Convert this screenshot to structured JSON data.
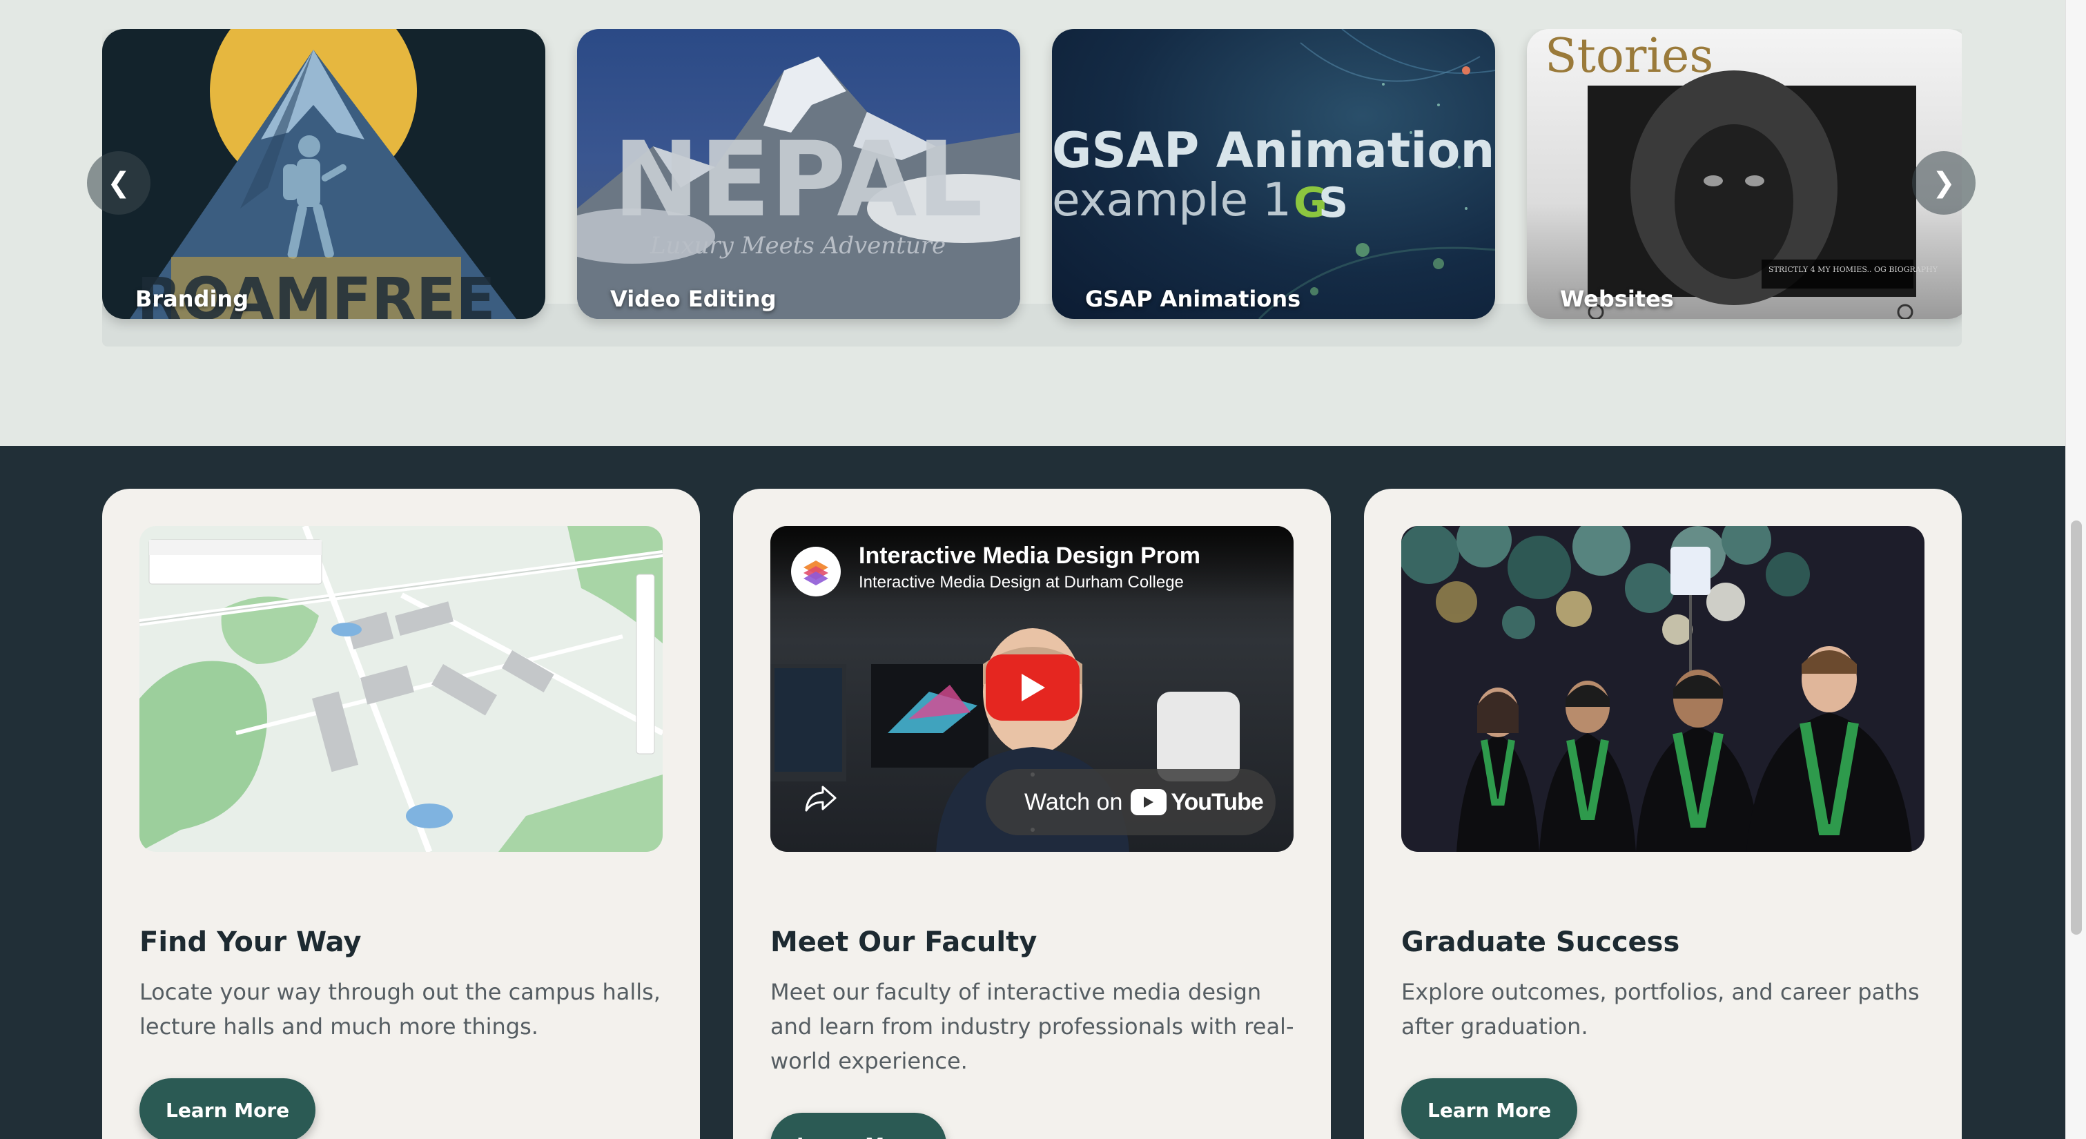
{
  "carousel": {
    "prev_label": "❮",
    "next_label": "❯",
    "cards": [
      {
        "label": "Branding",
        "overlay_text": "ROAMFREE"
      },
      {
        "label": "Video Editing",
        "overlay_text": "NEPAL",
        "overlay_subtext": "Luxury Meets Adventure"
      },
      {
        "label": "GSAP Animations",
        "overlay_text": "GSAP Animation",
        "overlay_subtext": "example 1"
      },
      {
        "label": "Websites",
        "overlay_text": "Stories",
        "overlay_subtext": "STRICTLY 4 MY HOMIES.. OG BIOGRAPHY"
      }
    ]
  },
  "info_cards": [
    {
      "title": "Find Your Way",
      "description": "Locate your way through out the campus halls, lecture halls and much more things.",
      "button": "Learn More"
    },
    {
      "title": "Meet Our Faculty",
      "description": "Meet our faculty of interactive media design and learn from industry professionals with real-world experience.",
      "button": "Learn More",
      "video": {
        "title": "Interactive Media Design Prom",
        "channel": "Interactive Media Design at Durham College",
        "watch_on": "Watch on",
        "brand": "YouTube"
      }
    },
    {
      "title": "Graduate Success",
      "description": "Explore outcomes, portfolios, and career paths after graduation.",
      "button": "Learn More"
    }
  ],
  "colors": {
    "top_bg": "#e3e8e4",
    "dark_bg": "#212f37",
    "card_bg": "#f3f1ed",
    "button_bg": "#2b5a54"
  }
}
